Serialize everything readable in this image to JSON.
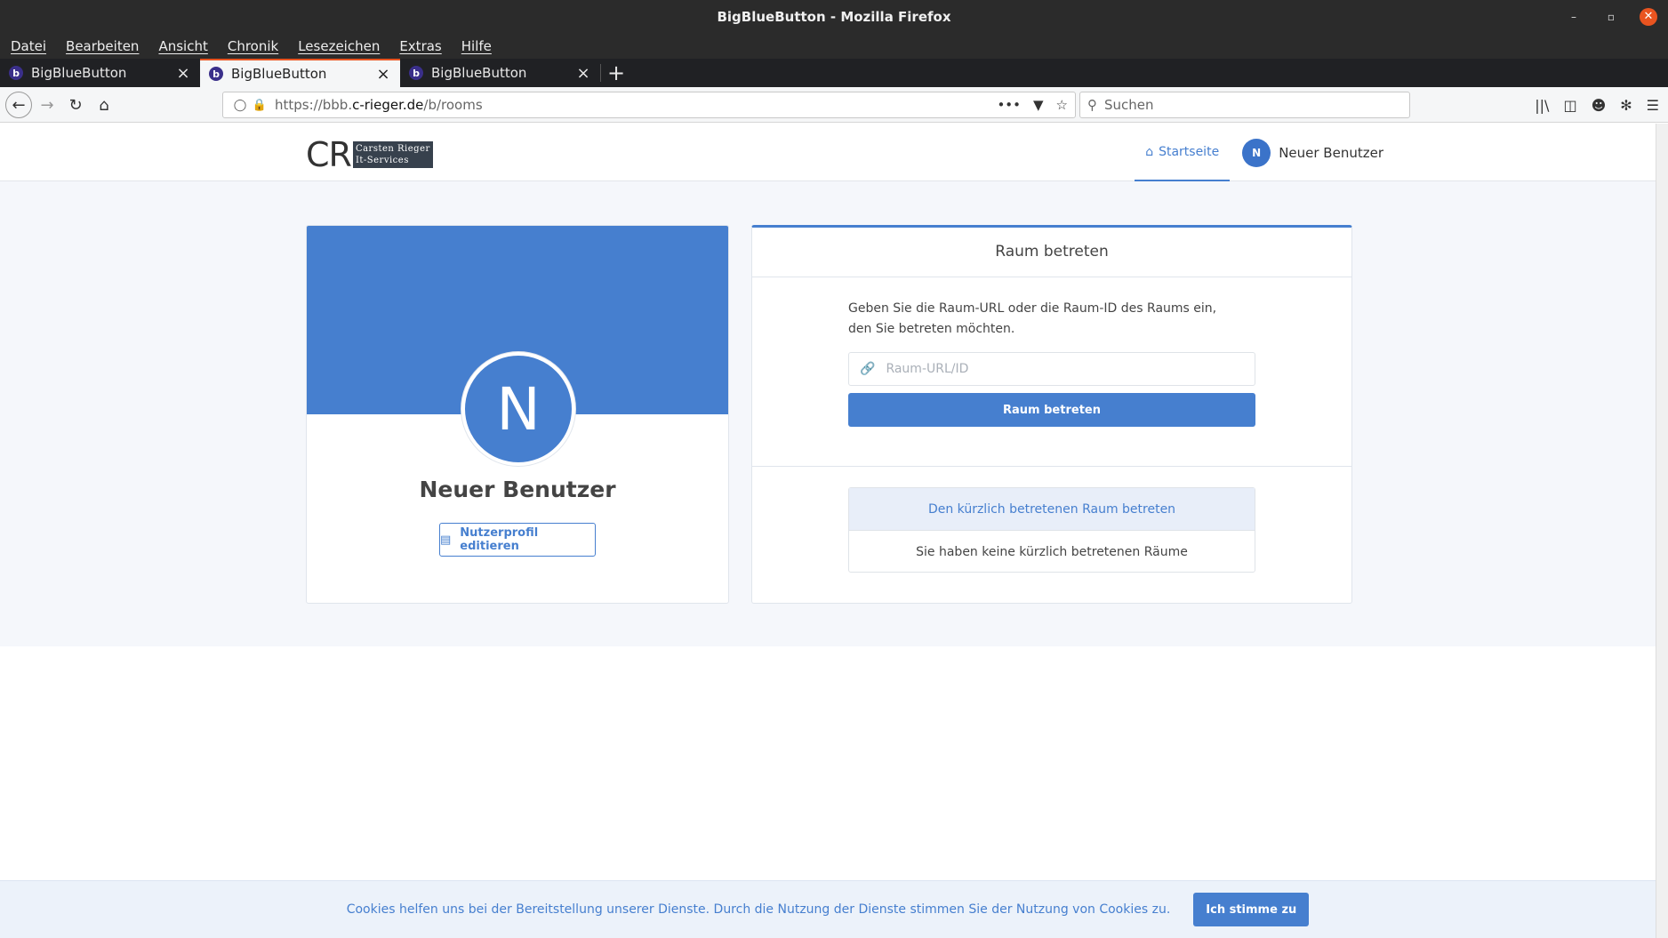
{
  "window": {
    "title": "BigBlueButton - Mozilla Firefox"
  },
  "menu": [
    "Datei",
    "Bearbeiten",
    "Ansicht",
    "Chronik",
    "Lesezeichen",
    "Extras",
    "Hilfe"
  ],
  "tabs": [
    {
      "label": "BigBlueButton",
      "active": false
    },
    {
      "label": "BigBlueButton",
      "active": true
    },
    {
      "label": "BigBlueButton",
      "active": false
    }
  ],
  "address": {
    "prefix": "https://bbb.",
    "domain": "c-rieger.de",
    "path": "/b/rooms"
  },
  "search": {
    "placeholder": "Suchen"
  },
  "site": {
    "logo_initials": "CR",
    "logo_line1": "Carsten Rieger",
    "logo_line2": "It-Services",
    "nav_home": "Startseite",
    "user_initial": "N",
    "user_name": "Neuer Benutzer"
  },
  "profile": {
    "initial": "N",
    "name": "Neuer Benutzer",
    "edit_label": "Nutzerprofil editieren"
  },
  "join": {
    "title": "Raum betreten",
    "description": "Geben Sie die Raum-URL oder die Raum-ID des Raums ein, den Sie betreten möchten.",
    "input_placeholder": "Raum-URL/ID",
    "button": "Raum betreten",
    "recent_title": "Den kürzlich betretenen Raum betreten",
    "recent_empty": "Sie haben keine kürzlich betretenen Räume"
  },
  "cookie": {
    "text": "Cookies helfen uns bei der Bereitstellung unserer Dienste. Durch die Nutzung der Dienste stimmen Sie der Nutzung von Cookies zu.",
    "button": "Ich stimme zu"
  },
  "colors": {
    "accent": "#467fcf",
    "firefox_orange": "#e95420"
  }
}
